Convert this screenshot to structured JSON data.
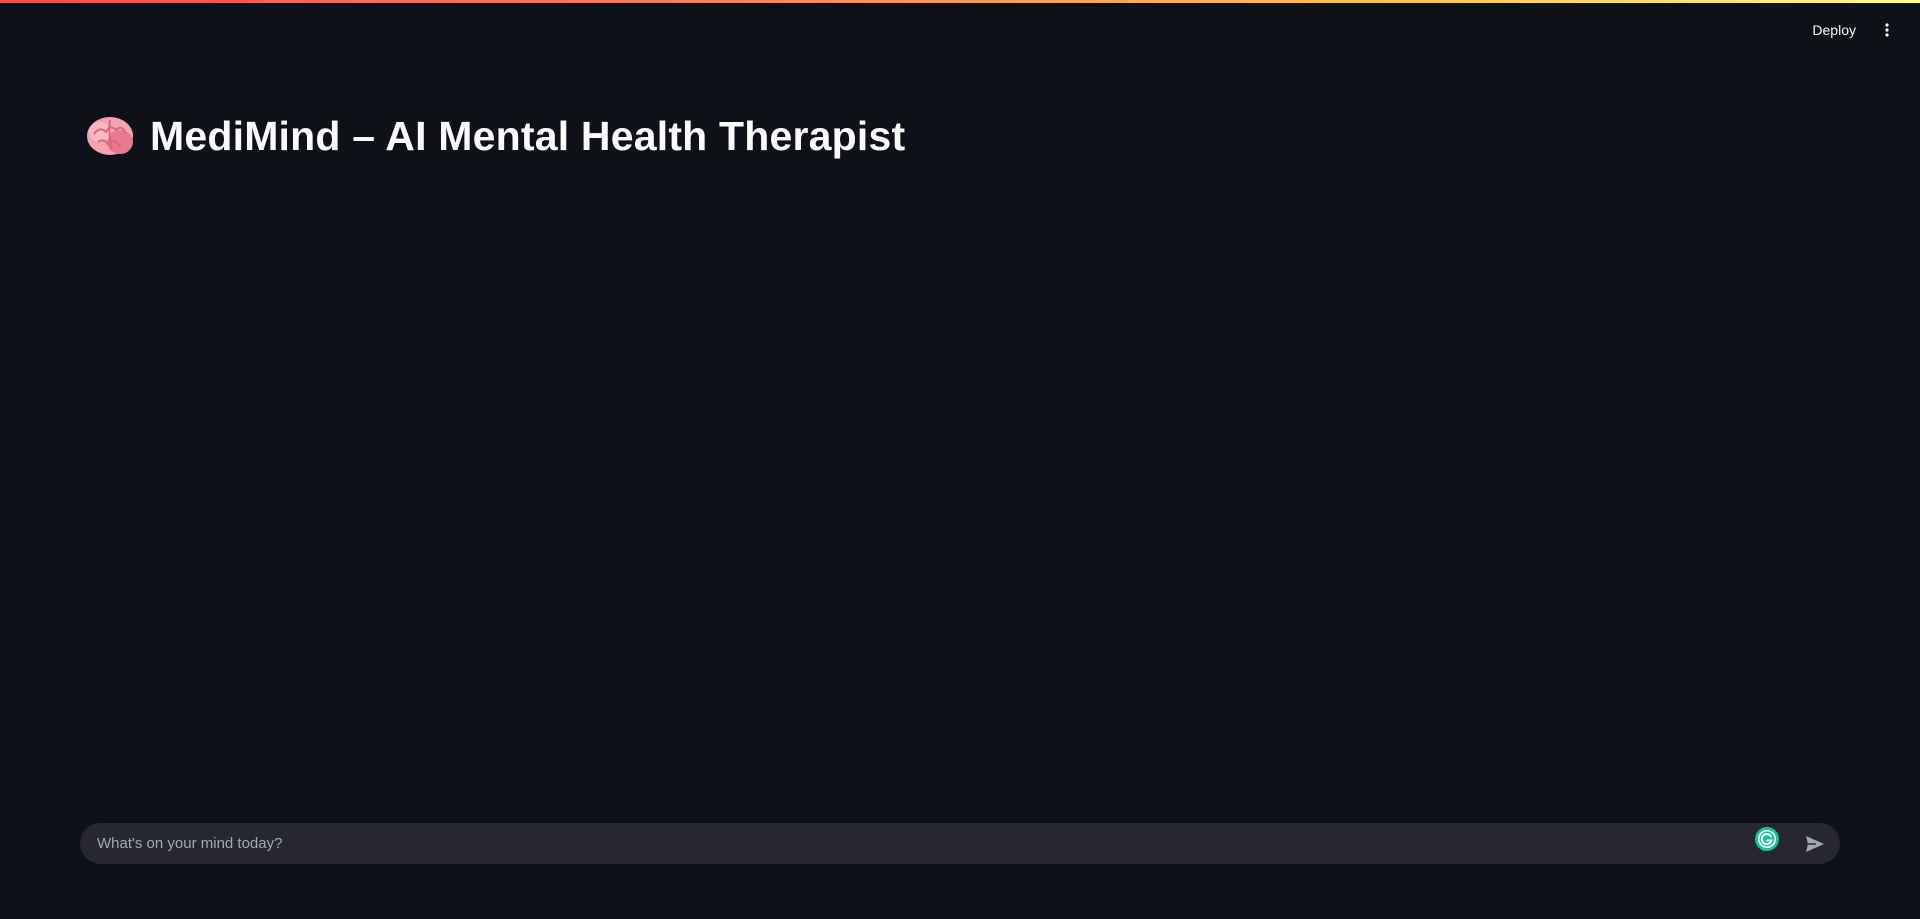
{
  "app": {
    "title": "MediMind – AI Mental Health Therapist"
  },
  "header": {
    "deploy_label": "Deploy",
    "menu_icon": "vertical-ellipsis-icon"
  },
  "main": {
    "title_icon": "brain-emoji-icon"
  },
  "chat": {
    "placeholder": "What's on your mind today?",
    "value": "",
    "extension_icon": "grammarly-icon",
    "send_icon": "send-icon"
  },
  "colors": {
    "background": "#0e1117",
    "input_background": "#262730",
    "text": "#fafafa",
    "placeholder": "#a3a8b8",
    "accent_gradient_start": "#ff4b4b",
    "accent_gradient_end": "#fffd80",
    "grammarly": "#15c39a"
  }
}
